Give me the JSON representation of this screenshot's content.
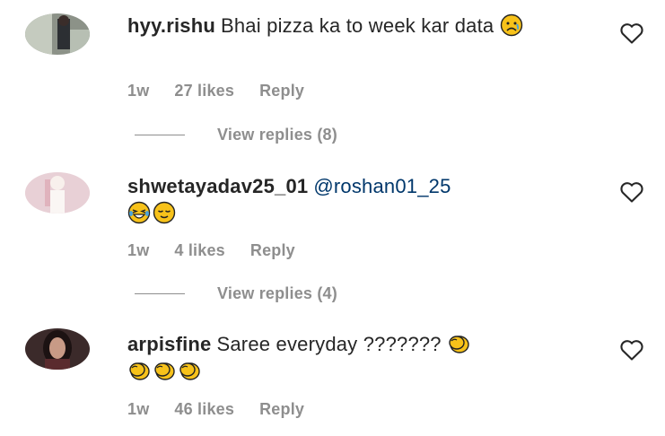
{
  "comments": [
    {
      "username": "hyy.rishu",
      "text": "Bhai pizza ka to week kar data",
      "emojis": [
        "sad-face-emoji"
      ],
      "time": "1w",
      "likes": "27 likes",
      "reply": "Reply",
      "view_replies": "View replies (8)"
    },
    {
      "username": "shwetayadav25_01",
      "mention": "@roshan01_25",
      "emojis": [
        "laughing-tears-emoji",
        "relieved-face-emoji"
      ],
      "time": "1w",
      "likes": "4 likes",
      "reply": "Reply",
      "view_replies": "View replies (4)"
    },
    {
      "username": "arpisfine",
      "text": "Saree everyday ???????",
      "emojis": [
        "clapping-hands-emoji",
        "clapping-hands-emoji",
        "clapping-hands-emoji",
        "clapping-hands-emoji"
      ],
      "time": "1w",
      "likes": "46 likes",
      "reply": "Reply"
    }
  ],
  "icons": {
    "like": "heart-outline-icon"
  },
  "colors": {
    "meta_gray": "#8e8e8e",
    "mention_blue": "#00376b",
    "emoji_yellow": "#f7c21a"
  }
}
